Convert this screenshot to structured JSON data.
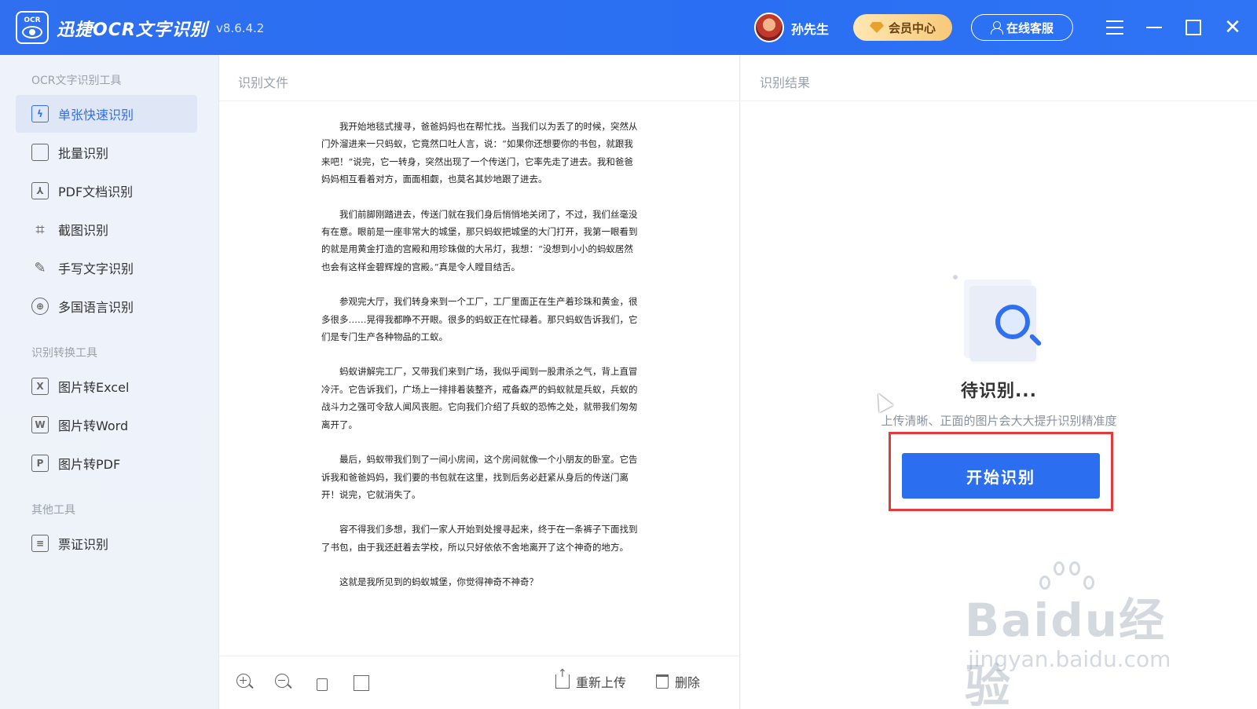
{
  "header": {
    "app_title": "迅捷OCR文字识别",
    "version": "v8.6.4.2",
    "logo_text": "OCR",
    "username": "孙先生",
    "vip_label": "会员中心",
    "service_label": "在线客服"
  },
  "sidebar": {
    "section1": "OCR文字识别工具",
    "section2": "识别转换工具",
    "section3": "其他工具",
    "items": [
      {
        "label": "单张快速识别",
        "icon": "lightning-doc-icon",
        "active": true
      },
      {
        "label": "批量识别",
        "icon": "stack-icon"
      },
      {
        "label": "PDF文档识别",
        "icon": "pdf-icon"
      },
      {
        "label": "截图识别",
        "icon": "crop-icon"
      },
      {
        "label": "手写文字识别",
        "icon": "pen-icon"
      },
      {
        "label": "多国语言识别",
        "icon": "globe-icon"
      },
      {
        "label": "图片转Excel",
        "icon": "excel-icon",
        "glyph": "X"
      },
      {
        "label": "图片转Word",
        "icon": "word-icon",
        "glyph": "W"
      },
      {
        "label": "图片转PDF",
        "icon": "pdf-file-icon",
        "glyph": "P"
      },
      {
        "label": "票证识别",
        "icon": "ticket-icon"
      }
    ]
  },
  "middle": {
    "title": "识别文件",
    "paragraphs": [
      "我开始地毯式搜寻，爸爸妈妈也在帮忙找。当我们以为丢了的时候，突然从门外溜进来一只蚂蚁，它竟然口吐人言，说：“如果你还想要你的书包，就跟我来吧！”说完，它一转身，突然出现了一个传送门，它率先走了进去。我和爸爸妈妈相互看着对方，面面相觑，也莫名其妙地跟了进去。",
      "我们前脚刚踏进去，传送门就在我们身后悄悄地关闭了，不过，我们丝毫没有在意。眼前是一座非常大的城堡，那只蚂蚁把城堡的大门打开，我第一眼看到的就是用黄金打造的宫殿和用珍珠做的大吊灯，我想：“没想到小小的蚂蚁居然也会有这样金碧辉煌的宫殿。”真是令人瞠目结舌。",
      "参观完大厅，我们转身来到一个工厂，工厂里面正在生产着珍珠和黄金，很多很多……晃得我都睁不开眼。很多的蚂蚁正在忙碌着。那只蚂蚁告诉我们，它们是专门生产各种物品的工蚁。",
      "蚂蚁讲解完工厂，又带我们来到广场，我似乎闻到一股肃杀之气，背上直冒冷汗。它告诉我们，广场上一排排着装整齐，戒备森严的蚂蚁就是兵蚁，兵蚁的战斗力之强可令敌人闻风丧胆。它向我们介绍了兵蚁的恐怖之处，就带我们匆匆离开了。",
      "最后，蚂蚁带我们到了一间小房间，这个房间就像一个小朋友的卧室。它告诉我和爸爸妈妈，我们要的书包就在这里，找到后务必赶紧从身后的传送门离开！说完，它就消失了。",
      "容不得我们多想，我们一家人开始到处搜寻起来，终于在一条裤子下面找到了书包，由于我还赶着去学校，所以只好依依不舍地离开了这个神奇的地方。",
      "这就是我所见到的蚂蚁城堡，你觉得神奇不神奇？"
    ],
    "toolbar": {
      "reupload_label": "重新上传",
      "delete_label": "删除"
    }
  },
  "right": {
    "title": "识别结果",
    "waiting_title": "待识别...",
    "tip": "上传清晰、正面的图片会大大提升识别精准度",
    "start_label": "开始识别"
  },
  "watermark": {
    "main": "Baidu经验",
    "sub": "jingyan.baidu.com"
  },
  "colors": {
    "primary": "#2f6ff0",
    "highlight": "#e23b3b",
    "vip_gold": "#f7c979"
  }
}
